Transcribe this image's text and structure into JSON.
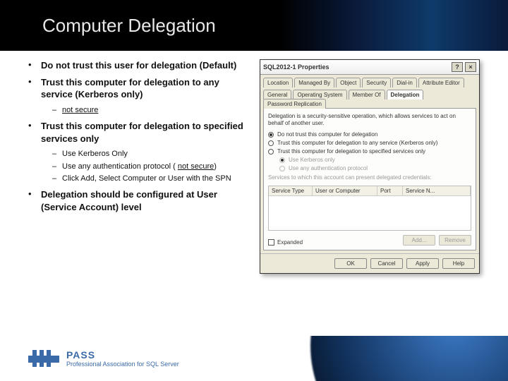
{
  "slide": {
    "title": "Computer Delegation",
    "bullets": [
      {
        "text": "Do not trust this user for delegation (Default)",
        "sub": []
      },
      {
        "text": "Trust this computer for delegation to any service (Kerberos only)",
        "sub": [
          {
            "text": "not secure",
            "underline": true
          }
        ]
      },
      {
        "text": "Trust this computer for delegation to specified services only",
        "sub": [
          {
            "text": "Use Kerberos Only"
          },
          {
            "text": "Use any authentication protocol ( ",
            "tail_underline": "not secure",
            "tail_after": ")"
          },
          {
            "text": "Click Add, Select Computer or User with the SPN"
          }
        ]
      },
      {
        "text": "Delegation should be configured at User (Service Account) level",
        "sub": []
      }
    ]
  },
  "dialog": {
    "title": "SQL2012-1 Properties",
    "help_btn": "?",
    "close_btn": "×",
    "tabs_row1": [
      "Location",
      "Managed By",
      "Object",
      "Security",
      "Dial-in",
      "Attribute Editor"
    ],
    "tabs_row2": [
      "General",
      "Operating System",
      "Member Of",
      "Delegation",
      "Password Replication"
    ],
    "active_tab": "Delegation",
    "note": "Delegation is a security-sensitive operation, which allows services to act on behalf of another user.",
    "options": {
      "o1": "Do not trust this computer for delegation",
      "o2": "Trust this computer for delegation to any service (Kerberos only)",
      "o3": "Trust this computer for delegation to specified services only",
      "sub1": "Use Kerberos only",
      "sub2": "Use any authentication protocol",
      "svc_label": "Services to which this account can present delegated credentials:"
    },
    "svc_cols": [
      "Service Type",
      "User or Computer",
      "Port",
      "Service N..."
    ],
    "expanded_label": "Expanded",
    "add_btn": "Add...",
    "remove_btn": "Remove",
    "footer_btns": {
      "ok": "OK",
      "cancel": "Cancel",
      "apply": "Apply",
      "help": "Help"
    }
  },
  "footer": {
    "brand": "PASS",
    "tagline": "Professional Association for SQL Server"
  }
}
